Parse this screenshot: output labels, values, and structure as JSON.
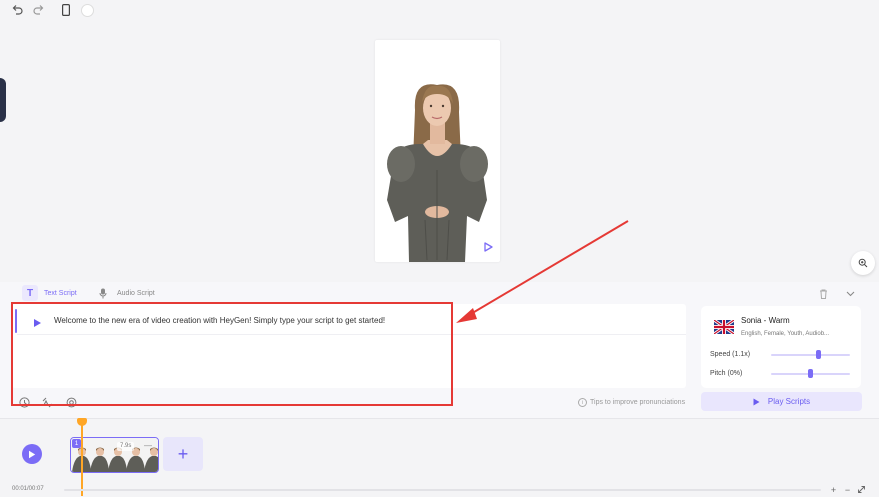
{
  "toolbar": {
    "undo_icon": "undo-icon",
    "redo_icon": "redo-icon",
    "device_icon": "phone-icon"
  },
  "tabs": [
    {
      "label": "Text Script",
      "active": true
    },
    {
      "label": "Audio Script",
      "active": false
    }
  ],
  "script": {
    "text": "Welcome to the new era of video creation with HeyGen! Simply type your script to get started!"
  },
  "footer": {
    "tips": "Tips to improve pronunciations"
  },
  "voice": {
    "name": "Sonia - Warm",
    "desc": "English, Female, Youth, Audiob...",
    "speed_label": "Speed (1.1x)",
    "speed_value": 0.55,
    "pitch_label": "Pitch (0%)",
    "pitch_value": 0.5
  },
  "play_scripts_label": "Play Scripts",
  "timeline": {
    "time": "00:01/00:07",
    "clip_index": "1",
    "clip_duration": "7.9s"
  },
  "colors": {
    "accent": "#7b6cf6",
    "highlight": "#e53935",
    "playhead": "#ffa626"
  }
}
